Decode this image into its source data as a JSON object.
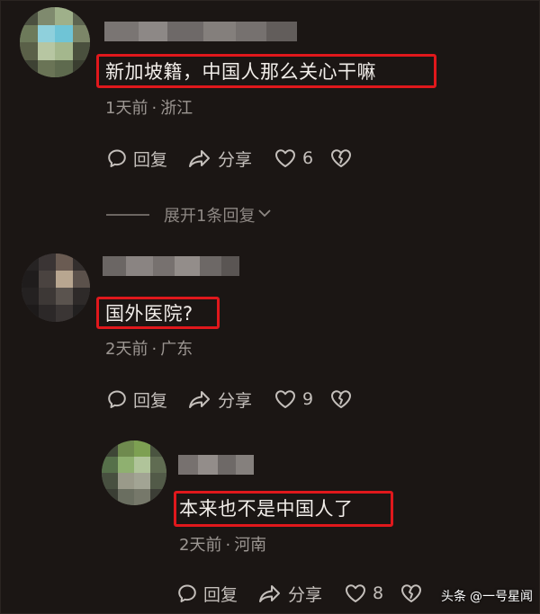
{
  "comments": [
    {
      "text": "新加坡籍，中国人那么关心干嘛",
      "date": "1天前",
      "location": "浙江",
      "reply_label": "回复",
      "share_label": "分享",
      "like_count": "6",
      "expand_label": "展开1条回复"
    },
    {
      "text": "国外医院?",
      "date": "2天前",
      "location": "广东",
      "reply_label": "回复",
      "share_label": "分享",
      "like_count": "9"
    },
    {
      "text": "本来也不是中国人了",
      "date": "2天前",
      "location": "河南",
      "reply_label": "回复",
      "share_label": "分享",
      "like_count": "8"
    }
  ],
  "separator": "·",
  "watermark": {
    "brand": "头条",
    "account": "@一号星闻"
  },
  "colors": {
    "background": "#1b1614",
    "highlight_border": "#e0181c",
    "meta_text": "#9c9692"
  },
  "icons": [
    "reply-icon",
    "share-icon",
    "like-icon",
    "dislike-icon",
    "chevron-down-icon"
  ]
}
